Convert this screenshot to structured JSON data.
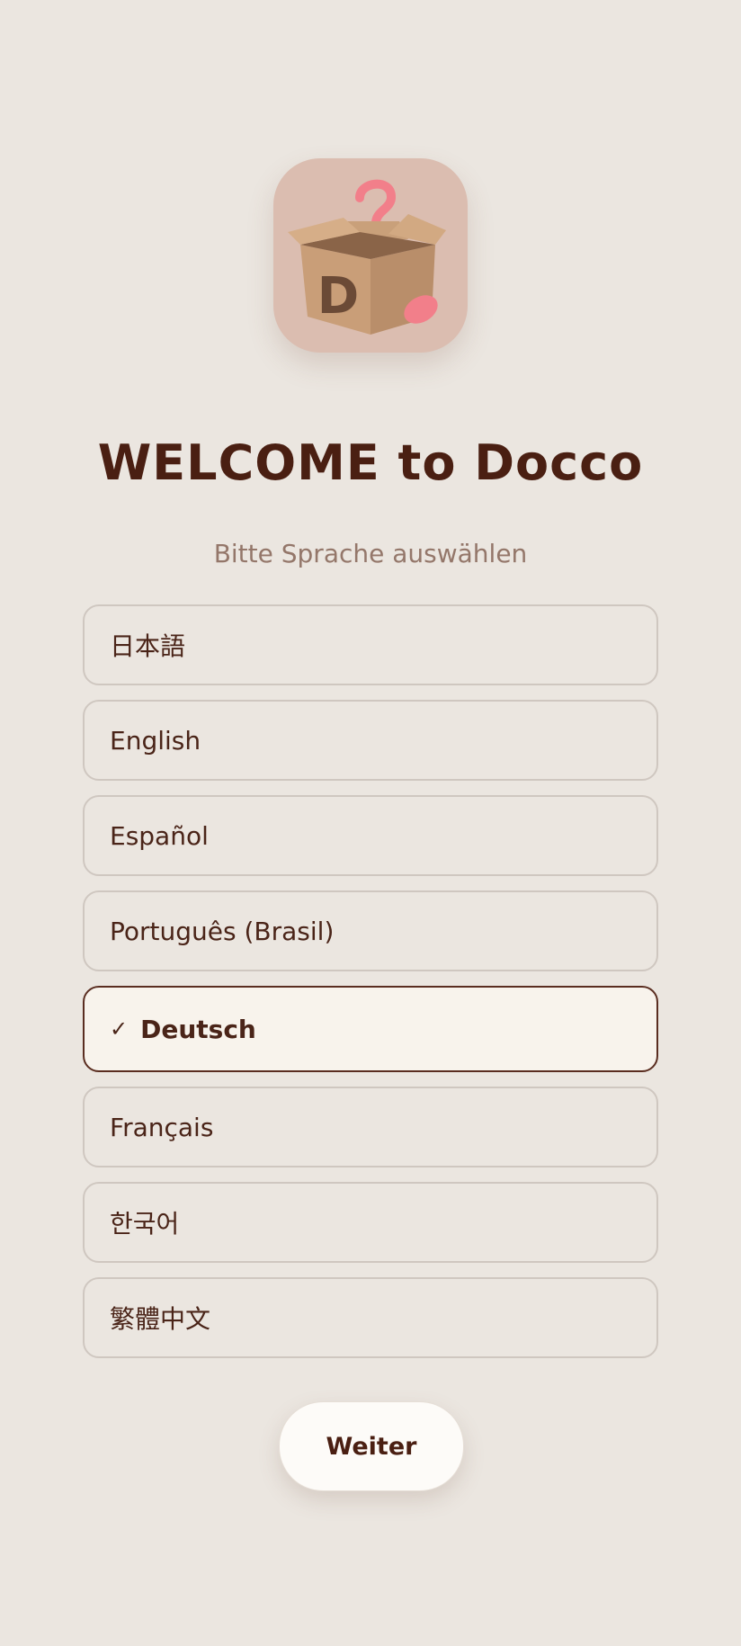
{
  "header": {
    "title": "WELCOME to Docco",
    "subtitle": "Bitte Sprache auswählen"
  },
  "logo": {
    "icon": "mystery-box-icon",
    "letter": "D",
    "background_color": "#dbbdb0"
  },
  "languages": [
    {
      "label": "日本語",
      "selected": false
    },
    {
      "label": "English",
      "selected": false
    },
    {
      "label": "Español",
      "selected": false
    },
    {
      "label": "Português (Brasil)",
      "selected": false
    },
    {
      "label": "Deutsch",
      "selected": true,
      "check_glyph": "✓"
    },
    {
      "label": "Français",
      "selected": false
    },
    {
      "label": "한국어",
      "selected": false
    },
    {
      "label": "繁體中文",
      "selected": false
    }
  ],
  "actions": {
    "continue_label": "Weiter"
  },
  "colors": {
    "background": "#ebe6e0",
    "title": "#4a1f12",
    "subtitle": "#94776a",
    "selected_border": "#5a2d20",
    "selected_background": "#f8f3ec"
  }
}
